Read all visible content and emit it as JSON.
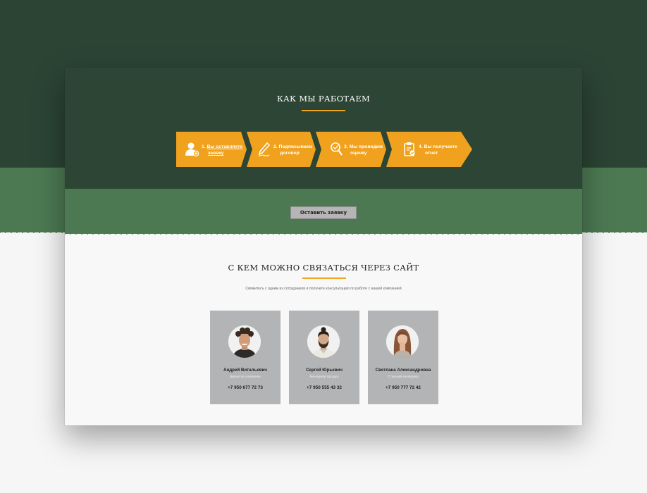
{
  "how": {
    "title": "КАК МЫ РАБОТАЕМ",
    "steps": [
      {
        "num": "1.",
        "line1": "Вы оставляете",
        "line2": "заявку",
        "icon": "user-add-icon"
      },
      {
        "num": "2.",
        "line1": "Подписываем",
        "line2": "договор",
        "icon": "pen-icon"
      },
      {
        "num": "3.",
        "line1": "Мы проводим",
        "line2": "оценку",
        "icon": "magnifier-check-icon"
      },
      {
        "num": "4.",
        "line1": "Вы получаете",
        "line2": "отчет",
        "icon": "clipboard-check-icon"
      }
    ],
    "accent": "#f0a21e"
  },
  "cta": {
    "button_label": "Оставить заявку"
  },
  "contacts": {
    "title": "С КЕМ МОЖНО СВЯЗАТЬСЯ ЧЕРЕЗ САЙТ",
    "subtitle": "Свяжитесь с одним из сотрудников и получите консультацию по работе с нашей компанией",
    "people": [
      {
        "name": "Андрей Витальевич",
        "role": "Директор компании",
        "phone": "+7 950 677 72 73"
      },
      {
        "name": "Сергей Юрьевич",
        "role": "Менеджер продаж",
        "phone": "+7 950 555 43 32"
      },
      {
        "name": "Светлана Александровна",
        "role": "Старший менеджер",
        "phone": "+7 950 777 72 42"
      }
    ]
  },
  "colors": {
    "dark_green": "#2c4534",
    "mid_green": "#4c7952",
    "orange": "#f0a21e",
    "card_gray": "#b3b4b6"
  }
}
